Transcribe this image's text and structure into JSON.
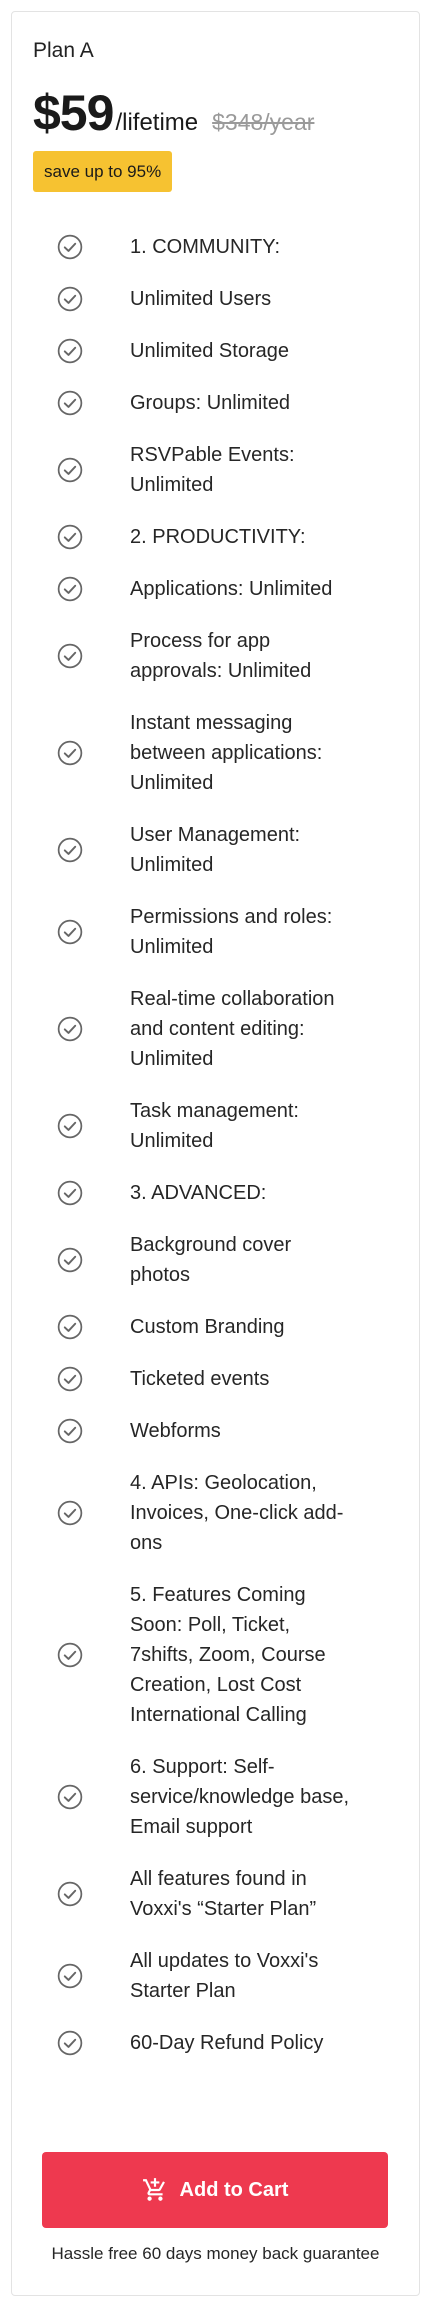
{
  "plan": {
    "name": "Plan A",
    "price": "$59",
    "period": "/lifetime",
    "old_price": "$348/year",
    "badge": "save up to 95%"
  },
  "features": [
    {
      "lines": [
        "1. COMMUNITY:"
      ]
    },
    {
      "lines": [
        "Unlimited Users"
      ]
    },
    {
      "lines": [
        "Unlimited Storage"
      ]
    },
    {
      "lines": [
        "Groups: Unlimited"
      ]
    },
    {
      "lines": [
        "RSVPable Events:",
        "Unlimited"
      ]
    },
    {
      "lines": [
        "2. PRODUCTIVITY:"
      ]
    },
    {
      "lines": [
        "Applications: Unlimited"
      ]
    },
    {
      "lines": [
        "Process for app",
        "approvals: Unlimited"
      ]
    },
    {
      "lines": [
        "Instant messaging",
        "between applications:",
        "Unlimited"
      ]
    },
    {
      "lines": [
        "User Management:",
        "Unlimited"
      ]
    },
    {
      "lines": [
        "Permissions and roles:",
        "Unlimited"
      ]
    },
    {
      "lines": [
        "Real-time collaboration",
        "and content editing:",
        "Unlimited"
      ]
    },
    {
      "lines": [
        "Task management:",
        "Unlimited"
      ]
    },
    {
      "lines": [
        "3. ADVANCED:"
      ]
    },
    {
      "lines": [
        "Background cover",
        "photos"
      ]
    },
    {
      "lines": [
        "Custom Branding"
      ]
    },
    {
      "lines": [
        "Ticketed events"
      ]
    },
    {
      "lines": [
        "Webforms"
      ]
    },
    {
      "lines": [
        "4. APIs: Geolocation,",
        "Invoices, One-click add-",
        "ons"
      ]
    },
    {
      "lines": [
        "5. Features Coming",
        "Soon: Poll, Ticket,",
        "7shifts, Zoom, Course",
        "Creation, Lost Cost",
        "International Calling"
      ]
    },
    {
      "lines": [
        "6. Support: Self-",
        "service/knowledge base,",
        "Email support"
      ]
    },
    {
      "lines": [
        "All features found in",
        "Voxxi's “Starter Plan”"
      ]
    },
    {
      "lines": [
        "All updates to Voxxi's",
        "Starter Plan"
      ]
    },
    {
      "lines": [
        "60-Day Refund Policy"
      ]
    }
  ],
  "feature_icon": "check-circle-icon",
  "colors": {
    "accent": "#ee394f",
    "badge": "#f6c231",
    "check": "#666666"
  },
  "cta": {
    "label": "Add to Cart",
    "icon": "cart-plus-icon"
  },
  "guarantee": "Hassle free 60 days money back guarantee"
}
